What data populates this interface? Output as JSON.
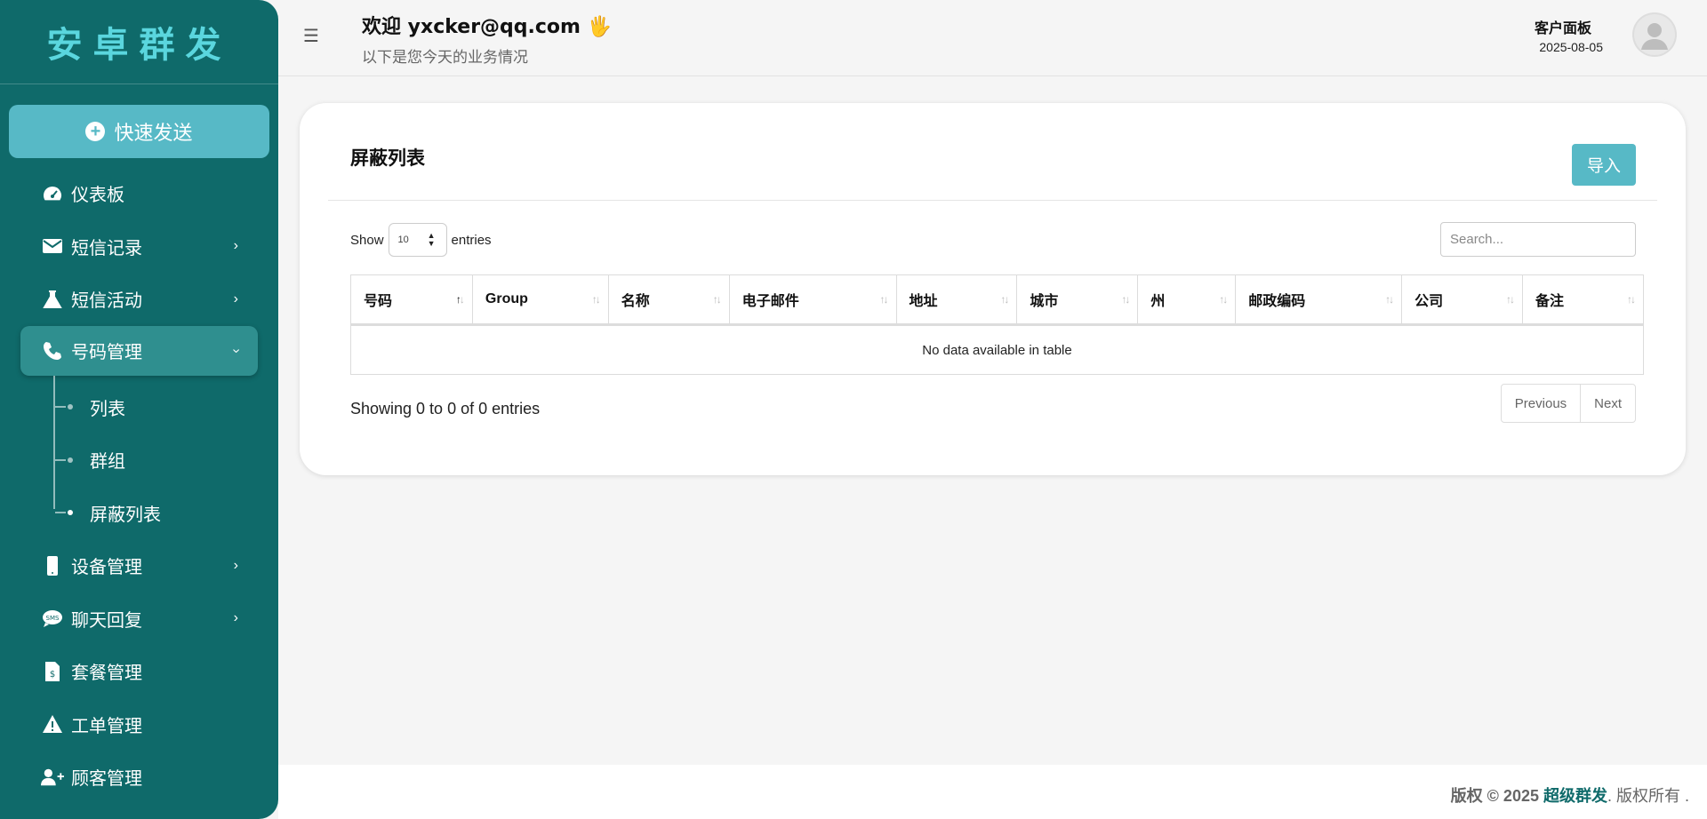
{
  "sidebar": {
    "brand": "安卓群发",
    "quick_send": "快速发送",
    "items": [
      {
        "label": "仪表板",
        "icon": "gauge-icon",
        "has_arrow": false
      },
      {
        "label": "短信记录",
        "icon": "envelope-icon",
        "has_arrow": true
      },
      {
        "label": "短信活动",
        "icon": "flask-icon",
        "has_arrow": true
      },
      {
        "label": "号码管理",
        "icon": "phone-icon",
        "has_arrow": true,
        "active": true
      }
    ],
    "sub_items": [
      {
        "label": "列表"
      },
      {
        "label": "群组"
      },
      {
        "label": "屏蔽列表",
        "current": true
      }
    ],
    "items_after": [
      {
        "label": "设备管理",
        "icon": "mobile-icon",
        "has_arrow": true
      },
      {
        "label": "聊天回复",
        "icon": "sms-bubble-icon",
        "has_arrow": true
      },
      {
        "label": "套餐管理",
        "icon": "invoice-icon",
        "has_arrow": false
      },
      {
        "label": "工单管理",
        "icon": "warning-icon",
        "has_arrow": false
      },
      {
        "label": "顾客管理",
        "icon": "user-plus-icon",
        "has_arrow": false
      }
    ]
  },
  "header": {
    "welcome": "欢迎 yxcker@qq.com 🖐",
    "subtitle": "以下是您今天的业务情况",
    "panel_label": "客户面板",
    "date": "2025-08-05"
  },
  "card": {
    "title": "屏蔽列表",
    "import_label": "导入",
    "show_label": "Show",
    "page_length": "10",
    "entries_label": "entries",
    "search_placeholder": "Search...",
    "columns": [
      "号码",
      "Group",
      "名称",
      "电子邮件",
      "地址",
      "城市",
      "州",
      "邮政编码",
      "公司",
      "备注"
    ],
    "empty_message": "No data available in table",
    "info": "Showing 0 to 0 of 0 entries",
    "prev_label": "Previous",
    "next_label": "Next"
  },
  "footer": {
    "prefix": "版权 © 2025 ",
    "brand": "超级群发",
    "suffix": ". 版权所有 ."
  },
  "colors": {
    "sidebar_bg": "#0f6a6a",
    "accent": "#57b9c6",
    "brand_text": "#5ad6de",
    "active_item": "#2f8f8f"
  }
}
